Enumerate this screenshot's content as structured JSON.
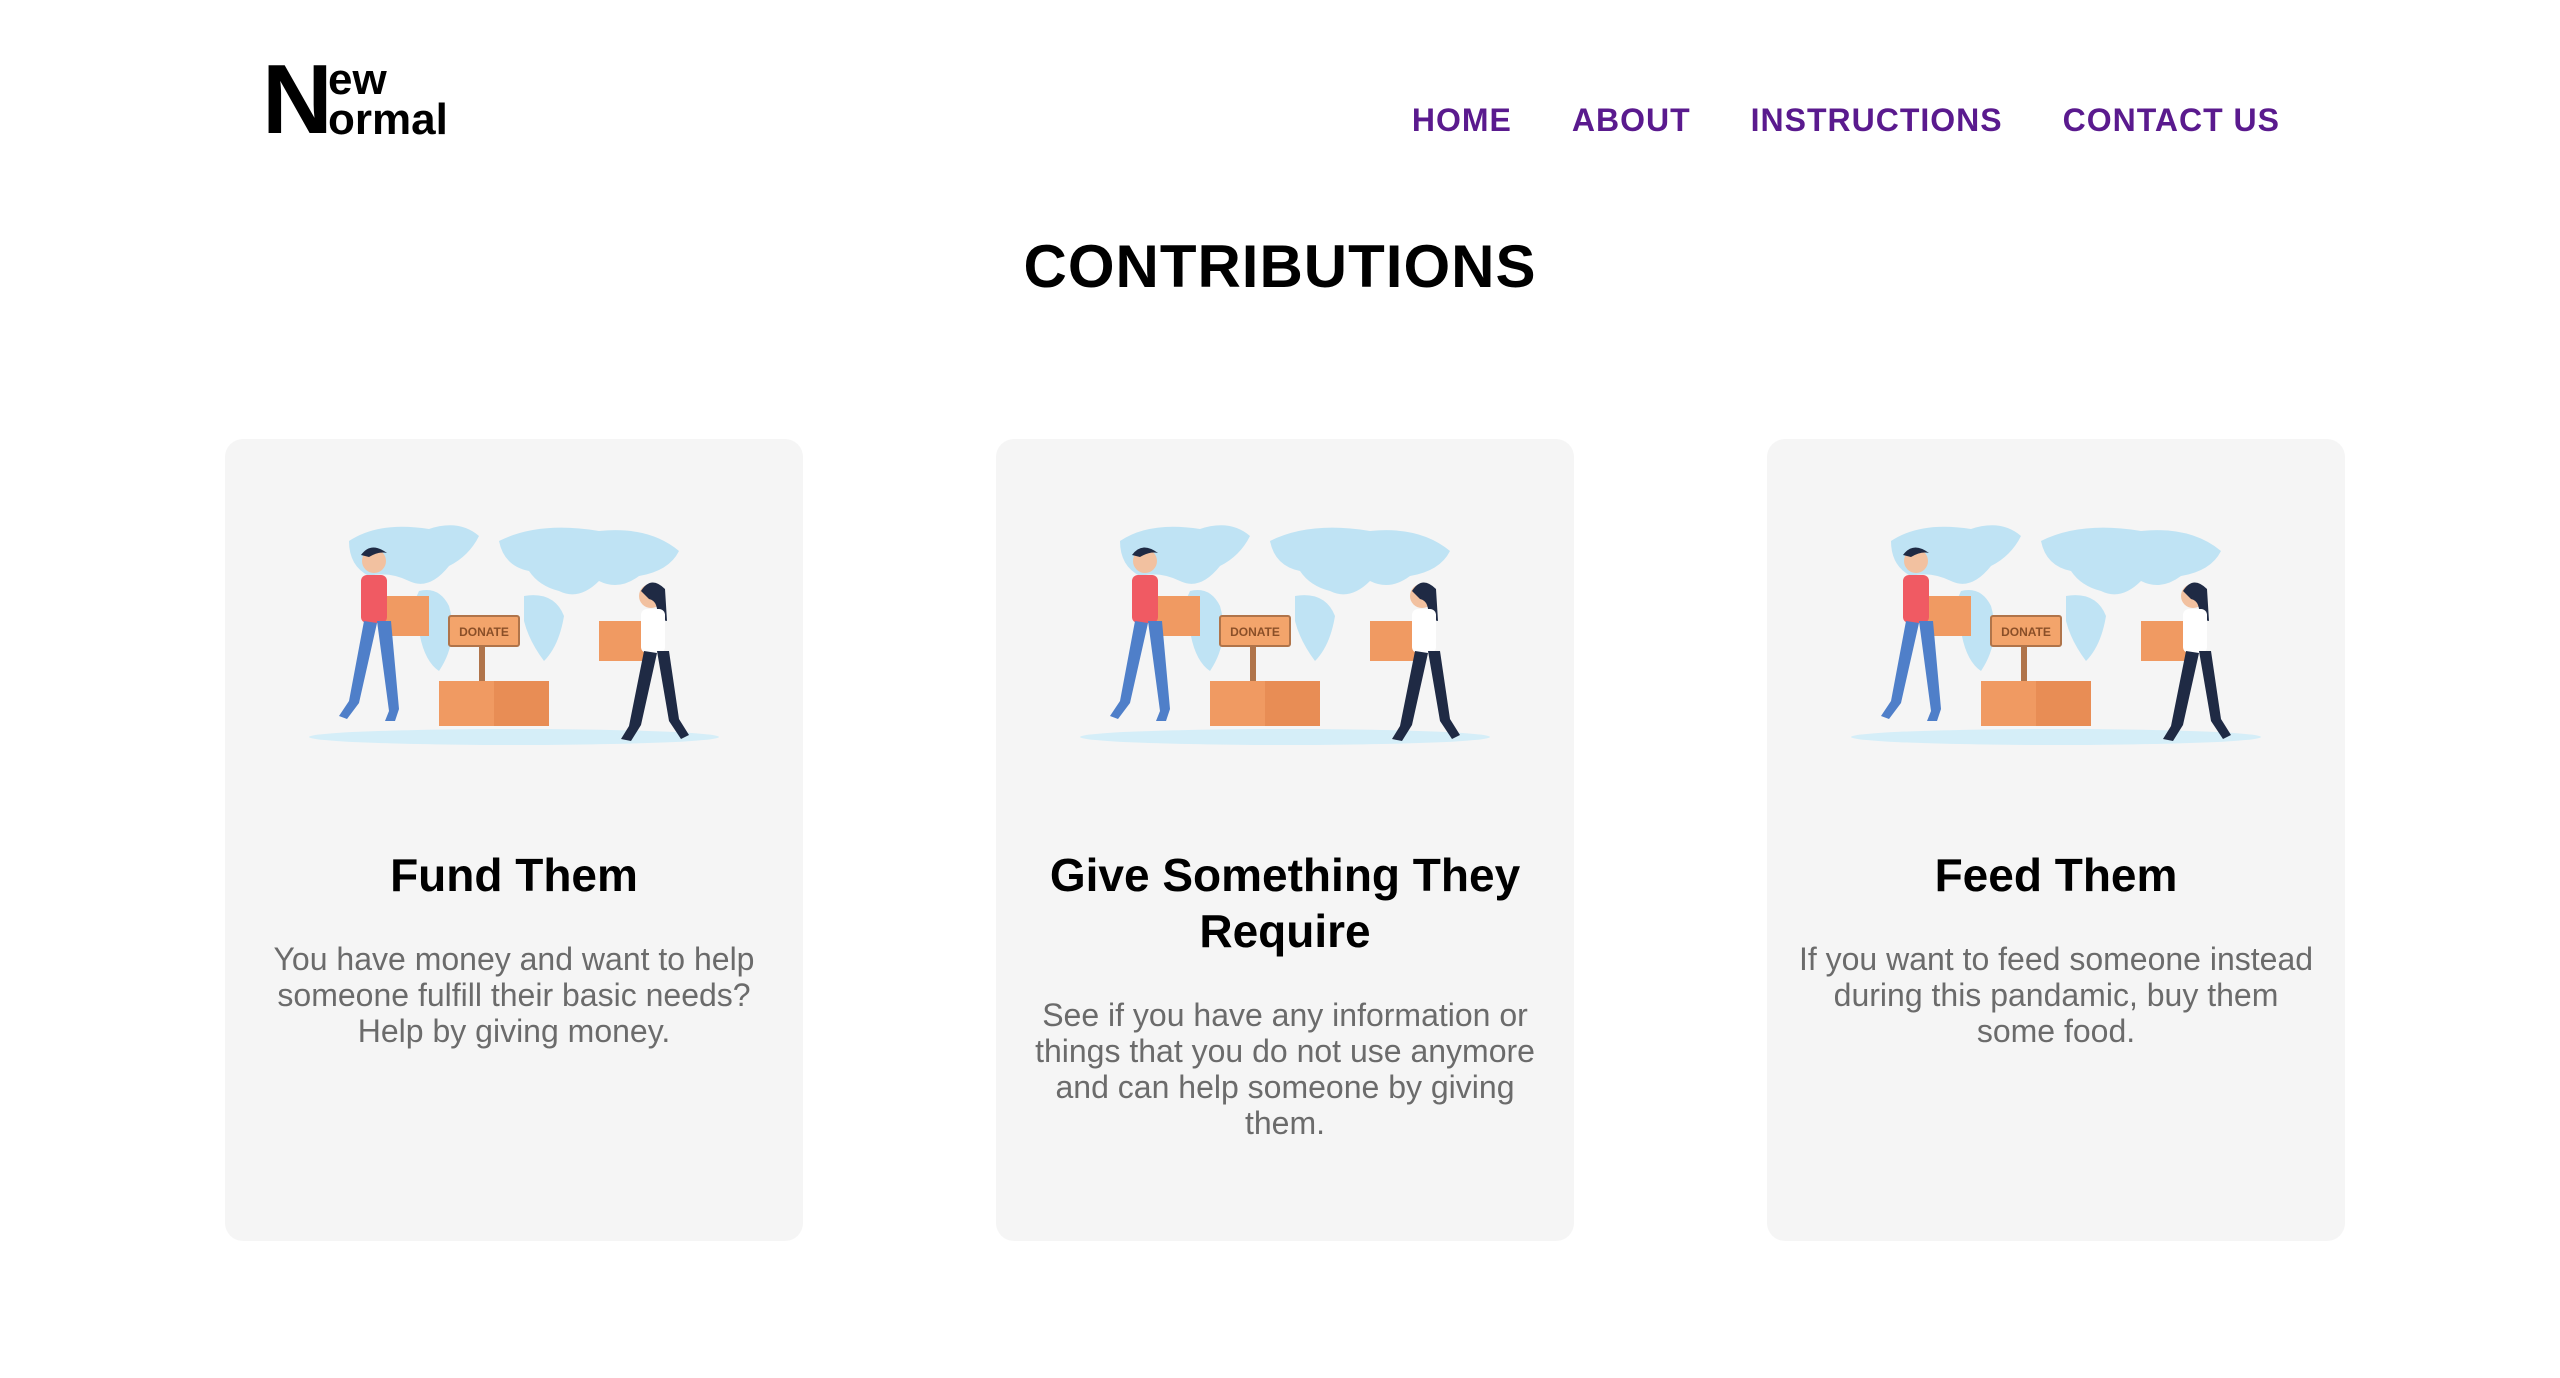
{
  "logo": {
    "n": "N",
    "line1": "ew",
    "line2": "ormal"
  },
  "nav": [
    {
      "label": "HOME"
    },
    {
      "label": "ABOUT"
    },
    {
      "label": "INSTRUCTIONS"
    },
    {
      "label": "CONTACT US"
    }
  ],
  "colors": {
    "nav": "#5a1a8e",
    "card_bg": "#f5f5f5",
    "body_text": "#6b6b6b"
  },
  "section": {
    "title": "CONTRIBUTIONS"
  },
  "cards": [
    {
      "title": "Fund Them",
      "text": "You have money and want to help someone fulfill their basic needs? Help by giving money.",
      "illustration": "donation-illustration",
      "sign": "DONATE"
    },
    {
      "title": "Give Something They Require",
      "text": "See if you have any information or things that you do not use anymore and can help someone by giving them.",
      "illustration": "donation-illustration",
      "sign": "DONATE"
    },
    {
      "title": "Feed Them",
      "text": "If you want to feed someone instead during this pandamic, buy them some food.",
      "illustration": "donation-illustration",
      "sign": "DONATE"
    }
  ]
}
